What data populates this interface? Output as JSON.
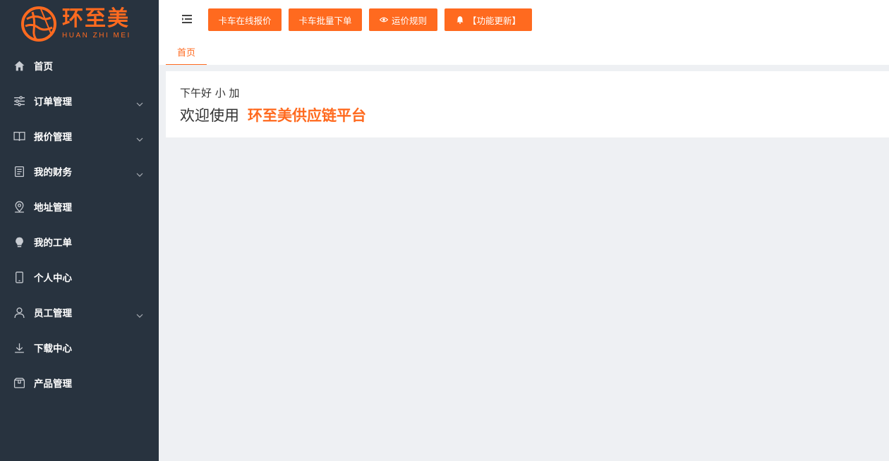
{
  "app": {
    "brand_cn": "环至美",
    "brand_en": "HUAN ZHI MEI",
    "accent_color": "#ff6a1f",
    "sidebar_color": "#28333f"
  },
  "sidebar": {
    "items": [
      {
        "label": "首页",
        "icon": "home-icon",
        "has_submenu": false
      },
      {
        "label": "订单管理",
        "icon": "sliders-icon",
        "has_submenu": true
      },
      {
        "label": "报价管理",
        "icon": "book-icon",
        "has_submenu": true
      },
      {
        "label": "我的财务",
        "icon": "document-icon",
        "has_submenu": true
      },
      {
        "label": "地址管理",
        "icon": "map-pin-icon",
        "has_submenu": false
      },
      {
        "label": "我的工单",
        "icon": "bulb-icon",
        "has_submenu": false
      },
      {
        "label": "个人中心",
        "icon": "mobile-icon",
        "has_submenu": false
      },
      {
        "label": "员工管理",
        "icon": "user-icon",
        "has_submenu": true
      },
      {
        "label": "下载中心",
        "icon": "download-icon",
        "has_submenu": false
      },
      {
        "label": "产品管理",
        "icon": "package-icon",
        "has_submenu": false
      }
    ]
  },
  "toolbar": {
    "buttons": [
      {
        "label": "卡车在线报价",
        "icon": null
      },
      {
        "label": "卡车批量下单",
        "icon": null
      },
      {
        "label": "运价规则",
        "icon": "eye-icon"
      },
      {
        "label": "【功能更新】",
        "icon": "bell-icon"
      }
    ]
  },
  "tabs": [
    {
      "label": "首页",
      "active": true
    }
  ],
  "welcome": {
    "greeting": "下午好 小 加",
    "prefix": "欢迎使用",
    "platform": "环至美供应链平台"
  }
}
